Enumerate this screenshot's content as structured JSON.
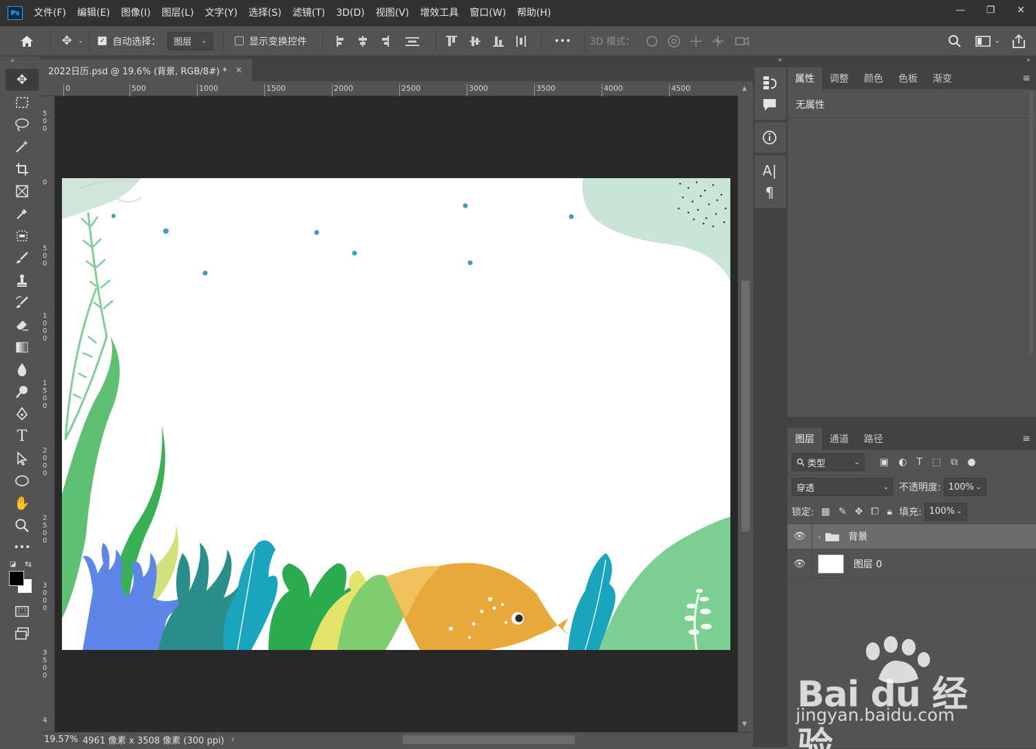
{
  "app": {
    "logo": "Ps",
    "menu": [
      "文件(F)",
      "编辑(E)",
      "图像(I)",
      "图层(L)",
      "文字(Y)",
      "选择(S)",
      "滤镜(T)",
      "3D(D)",
      "视图(V)",
      "增效工具",
      "窗口(W)",
      "帮助(H)"
    ],
    "window_controls": {
      "minimize": "—",
      "restore": "❐",
      "close": "✕"
    }
  },
  "options": {
    "auto_select_label": "自动选择：",
    "auto_select_target": "图层",
    "show_transform_label": "显示变换控件",
    "more_label": "•••",
    "mode_3d_label": "3D 模式："
  },
  "document": {
    "tab_title": "2022日历.psd @ 19.6% (背景, RGB/8#) *",
    "close_glyph": "✕",
    "ruler_top": [
      "0",
      "500",
      "1000",
      "1500",
      "2000",
      "2500",
      "3000",
      "3500",
      "4000",
      "4500"
    ],
    "ruler_left": [
      "500",
      "0",
      "500",
      "1000",
      "1500",
      "2000",
      "2500",
      "3000",
      "3500",
      "4"
    ]
  },
  "status": {
    "zoom": "19.57%",
    "doc_info": "4961 像素 x 3508 像素 (300 ppi)",
    "arrow": "›"
  },
  "properties_panel": {
    "tabs": [
      "属性",
      "调整",
      "颜色",
      "色板",
      "渐变"
    ],
    "empty_text": "无属性"
  },
  "layers_panel": {
    "tabs": [
      "图层",
      "通道",
      "路径"
    ],
    "filter_label": "类型",
    "blend_mode": "穿透",
    "opacity_label": "不透明度:",
    "opacity_value": "100%",
    "lock_label": "锁定:",
    "fill_label": "填充:",
    "fill_value": "100%",
    "layers": [
      {
        "name": "背景",
        "type": "group",
        "selected": true
      },
      {
        "name": "图层 0",
        "type": "pixel",
        "selected": false
      }
    ]
  },
  "watermark": {
    "brand": "Bai du 经验",
    "url": "jingyan.baidu.com"
  },
  "colors": {
    "accent": "#31a8ff",
    "panel_bg": "#535353",
    "dark_bg": "#282828",
    "title_bg": "#323232"
  }
}
